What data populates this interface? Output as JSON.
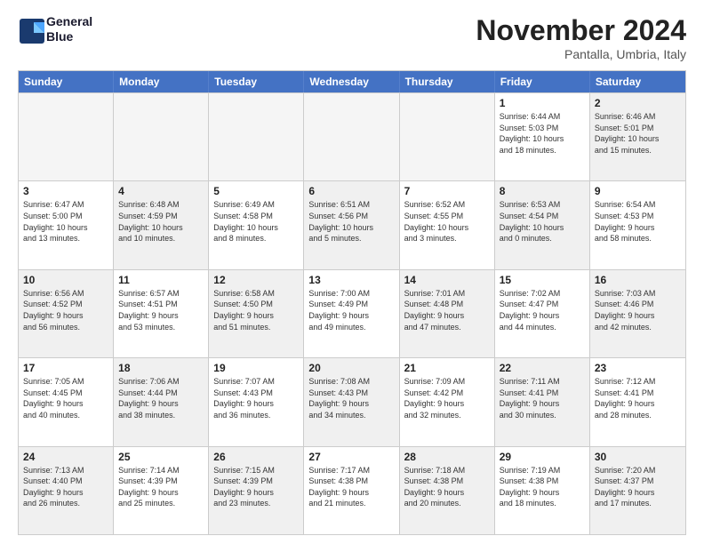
{
  "logo": {
    "line1": "General",
    "line2": "Blue"
  },
  "title": "November 2024",
  "subtitle": "Pantalla, Umbria, Italy",
  "header_days": [
    "Sunday",
    "Monday",
    "Tuesday",
    "Wednesday",
    "Thursday",
    "Friday",
    "Saturday"
  ],
  "rows": [
    [
      {
        "day": "",
        "info": "",
        "empty": true
      },
      {
        "day": "",
        "info": "",
        "empty": true
      },
      {
        "day": "",
        "info": "",
        "empty": true
      },
      {
        "day": "",
        "info": "",
        "empty": true
      },
      {
        "day": "",
        "info": "",
        "empty": true
      },
      {
        "day": "1",
        "info": "Sunrise: 6:44 AM\nSunset: 5:03 PM\nDaylight: 10 hours\nand 18 minutes.",
        "empty": false,
        "shaded": false
      },
      {
        "day": "2",
        "info": "Sunrise: 6:46 AM\nSunset: 5:01 PM\nDaylight: 10 hours\nand 15 minutes.",
        "empty": false,
        "shaded": true
      }
    ],
    [
      {
        "day": "3",
        "info": "Sunrise: 6:47 AM\nSunset: 5:00 PM\nDaylight: 10 hours\nand 13 minutes.",
        "empty": false,
        "shaded": false
      },
      {
        "day": "4",
        "info": "Sunrise: 6:48 AM\nSunset: 4:59 PM\nDaylight: 10 hours\nand 10 minutes.",
        "empty": false,
        "shaded": true
      },
      {
        "day": "5",
        "info": "Sunrise: 6:49 AM\nSunset: 4:58 PM\nDaylight: 10 hours\nand 8 minutes.",
        "empty": false,
        "shaded": false
      },
      {
        "day": "6",
        "info": "Sunrise: 6:51 AM\nSunset: 4:56 PM\nDaylight: 10 hours\nand 5 minutes.",
        "empty": false,
        "shaded": true
      },
      {
        "day": "7",
        "info": "Sunrise: 6:52 AM\nSunset: 4:55 PM\nDaylight: 10 hours\nand 3 minutes.",
        "empty": false,
        "shaded": false
      },
      {
        "day": "8",
        "info": "Sunrise: 6:53 AM\nSunset: 4:54 PM\nDaylight: 10 hours\nand 0 minutes.",
        "empty": false,
        "shaded": true
      },
      {
        "day": "9",
        "info": "Sunrise: 6:54 AM\nSunset: 4:53 PM\nDaylight: 9 hours\nand 58 minutes.",
        "empty": false,
        "shaded": false
      }
    ],
    [
      {
        "day": "10",
        "info": "Sunrise: 6:56 AM\nSunset: 4:52 PM\nDaylight: 9 hours\nand 56 minutes.",
        "empty": false,
        "shaded": true
      },
      {
        "day": "11",
        "info": "Sunrise: 6:57 AM\nSunset: 4:51 PM\nDaylight: 9 hours\nand 53 minutes.",
        "empty": false,
        "shaded": false
      },
      {
        "day": "12",
        "info": "Sunrise: 6:58 AM\nSunset: 4:50 PM\nDaylight: 9 hours\nand 51 minutes.",
        "empty": false,
        "shaded": true
      },
      {
        "day": "13",
        "info": "Sunrise: 7:00 AM\nSunset: 4:49 PM\nDaylight: 9 hours\nand 49 minutes.",
        "empty": false,
        "shaded": false
      },
      {
        "day": "14",
        "info": "Sunrise: 7:01 AM\nSunset: 4:48 PM\nDaylight: 9 hours\nand 47 minutes.",
        "empty": false,
        "shaded": true
      },
      {
        "day": "15",
        "info": "Sunrise: 7:02 AM\nSunset: 4:47 PM\nDaylight: 9 hours\nand 44 minutes.",
        "empty": false,
        "shaded": false
      },
      {
        "day": "16",
        "info": "Sunrise: 7:03 AM\nSunset: 4:46 PM\nDaylight: 9 hours\nand 42 minutes.",
        "empty": false,
        "shaded": true
      }
    ],
    [
      {
        "day": "17",
        "info": "Sunrise: 7:05 AM\nSunset: 4:45 PM\nDaylight: 9 hours\nand 40 minutes.",
        "empty": false,
        "shaded": false
      },
      {
        "day": "18",
        "info": "Sunrise: 7:06 AM\nSunset: 4:44 PM\nDaylight: 9 hours\nand 38 minutes.",
        "empty": false,
        "shaded": true
      },
      {
        "day": "19",
        "info": "Sunrise: 7:07 AM\nSunset: 4:43 PM\nDaylight: 9 hours\nand 36 minutes.",
        "empty": false,
        "shaded": false
      },
      {
        "day": "20",
        "info": "Sunrise: 7:08 AM\nSunset: 4:43 PM\nDaylight: 9 hours\nand 34 minutes.",
        "empty": false,
        "shaded": true
      },
      {
        "day": "21",
        "info": "Sunrise: 7:09 AM\nSunset: 4:42 PM\nDaylight: 9 hours\nand 32 minutes.",
        "empty": false,
        "shaded": false
      },
      {
        "day": "22",
        "info": "Sunrise: 7:11 AM\nSunset: 4:41 PM\nDaylight: 9 hours\nand 30 minutes.",
        "empty": false,
        "shaded": true
      },
      {
        "day": "23",
        "info": "Sunrise: 7:12 AM\nSunset: 4:41 PM\nDaylight: 9 hours\nand 28 minutes.",
        "empty": false,
        "shaded": false
      }
    ],
    [
      {
        "day": "24",
        "info": "Sunrise: 7:13 AM\nSunset: 4:40 PM\nDaylight: 9 hours\nand 26 minutes.",
        "empty": false,
        "shaded": true
      },
      {
        "day": "25",
        "info": "Sunrise: 7:14 AM\nSunset: 4:39 PM\nDaylight: 9 hours\nand 25 minutes.",
        "empty": false,
        "shaded": false
      },
      {
        "day": "26",
        "info": "Sunrise: 7:15 AM\nSunset: 4:39 PM\nDaylight: 9 hours\nand 23 minutes.",
        "empty": false,
        "shaded": true
      },
      {
        "day": "27",
        "info": "Sunrise: 7:17 AM\nSunset: 4:38 PM\nDaylight: 9 hours\nand 21 minutes.",
        "empty": false,
        "shaded": false
      },
      {
        "day": "28",
        "info": "Sunrise: 7:18 AM\nSunset: 4:38 PM\nDaylight: 9 hours\nand 20 minutes.",
        "empty": false,
        "shaded": true
      },
      {
        "day": "29",
        "info": "Sunrise: 7:19 AM\nSunset: 4:38 PM\nDaylight: 9 hours\nand 18 minutes.",
        "empty": false,
        "shaded": false
      },
      {
        "day": "30",
        "info": "Sunrise: 7:20 AM\nSunset: 4:37 PM\nDaylight: 9 hours\nand 17 minutes.",
        "empty": false,
        "shaded": true
      }
    ]
  ]
}
